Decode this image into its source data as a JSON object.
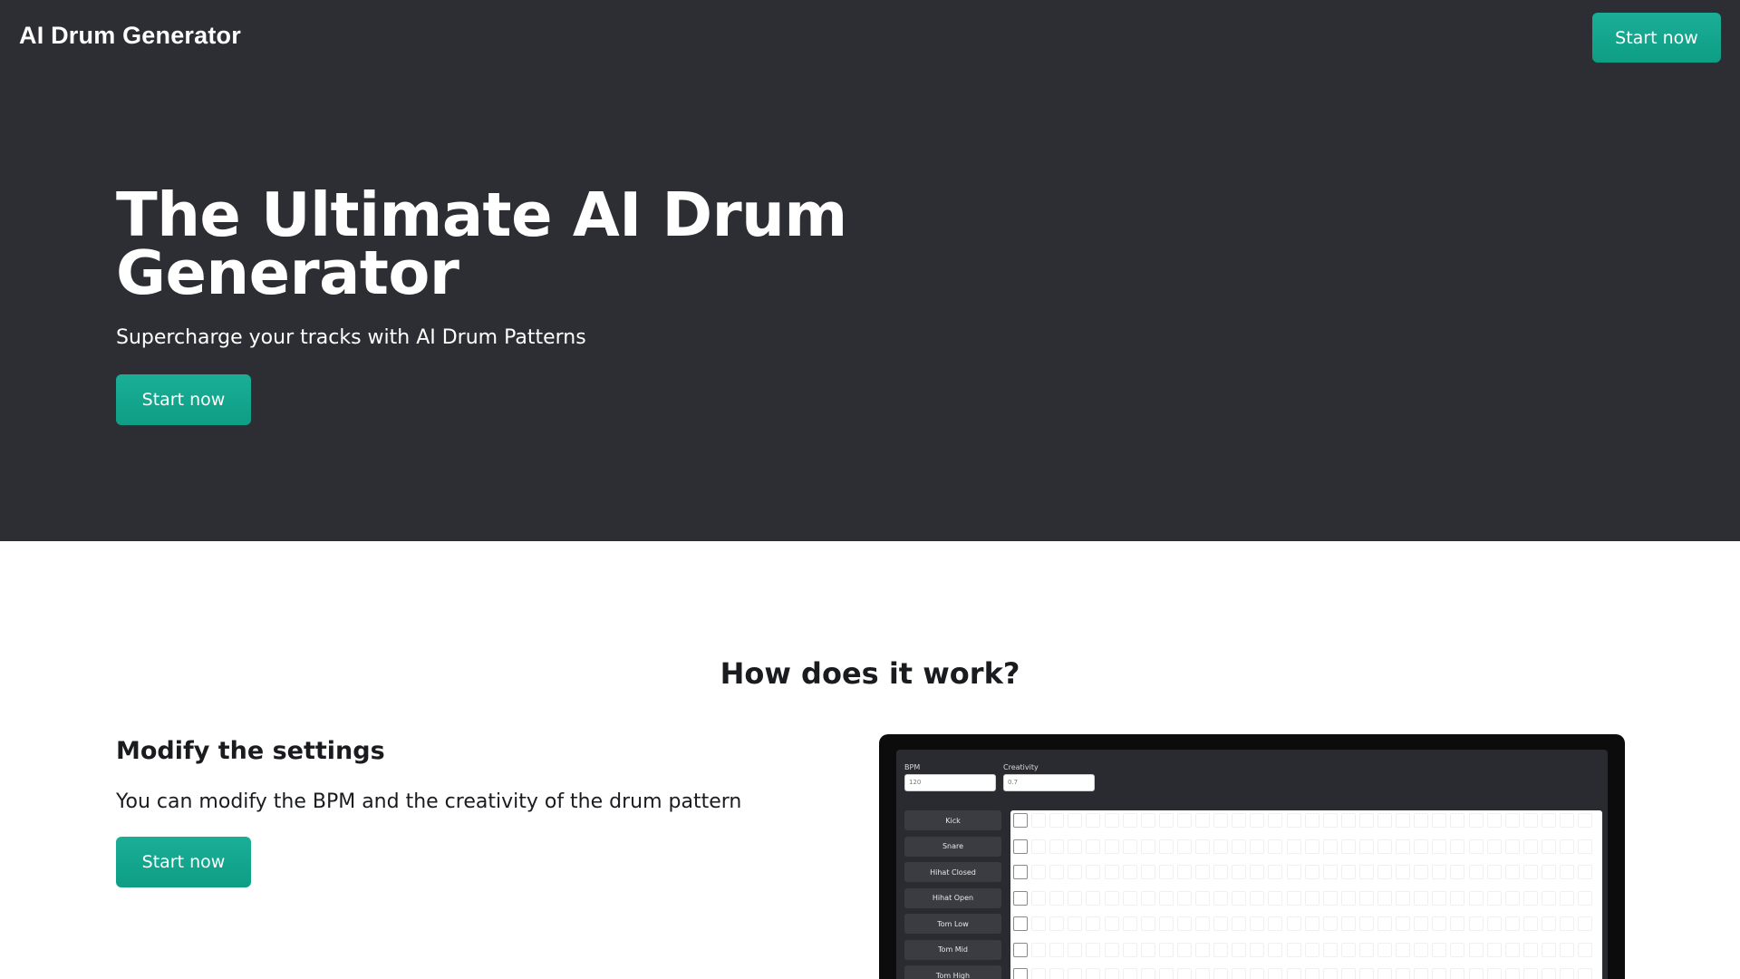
{
  "header": {
    "brand": "AI Drum Generator",
    "cta_label": "Start now"
  },
  "hero": {
    "title": "The Ultimate AI Drum Generator",
    "subtitle": "Supercharge your tracks with AI Drum Patterns",
    "cta_label": "Start now"
  },
  "how": {
    "title": "How does it work?",
    "step": {
      "title": "Modify the settings",
      "description": "You can modify the BPM and the creativity of the drum pattern",
      "cta_label": "Start now"
    }
  },
  "preview": {
    "bpm_label": "BPM",
    "bpm_value": "120",
    "creativity_label": "Creativity",
    "creativity_value": "0.7",
    "tracks": [
      "Kick",
      "Snare",
      "Hihat Closed",
      "Hihat Open",
      "Tom Low",
      "Tom Mid",
      "Tom High"
    ],
    "steps": 32
  },
  "colors": {
    "hero_bg": "#2d2e33",
    "accent": "#13a68d",
    "page_bg": "#ffffff",
    "text": "#1a1b1f"
  }
}
